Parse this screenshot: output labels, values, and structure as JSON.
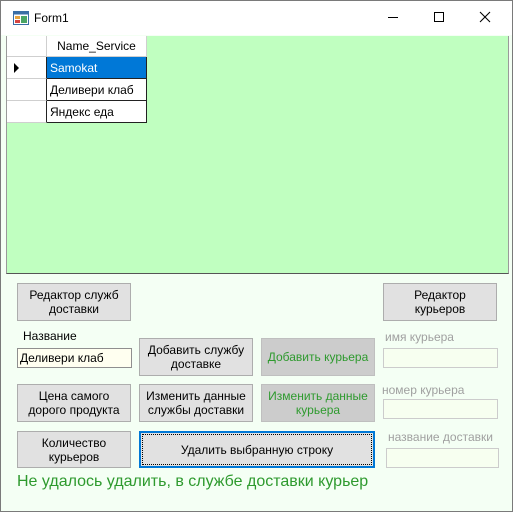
{
  "window": {
    "title": "Form1",
    "icon": "winforms-app-icon",
    "controls": [
      "minimize-icon",
      "maximize-icon",
      "close-icon"
    ]
  },
  "grid": {
    "column_header": "Name_Service",
    "rows": [
      "Samokat",
      "Деливери клаб",
      "Яндекс еда"
    ],
    "selected_row": 0
  },
  "buttons": {
    "service_editor": "Редактор служб доставки",
    "courier_editor": "Редактор курьеров",
    "add_service": "Добавить службу доставке",
    "add_courier": "Добавить курьера",
    "most_expensive": "Цена самого дорого продукта",
    "change_service": "Изменить данные службы доставки",
    "change_courier": "Изменить данные курьера",
    "courier_count": "Количество курьеров",
    "delete_row": "Удалить выбранную строку"
  },
  "fields": {
    "name_label": "Название",
    "name_value": "Деливери клаб",
    "courier_name_label": "имя курьера",
    "courier_name_value": "",
    "courier_number_label": "номер курьера",
    "courier_number_value": "",
    "delivery_name_label": "название доставки",
    "delivery_name_value": ""
  },
  "status_message": "Не удалось удалить, в службе доставки курьер",
  "colors": {
    "grid_background": "#c0ffc0",
    "form_background": "#f4fff4",
    "selection": "#0078d7",
    "status_text": "#2e9a2e"
  }
}
